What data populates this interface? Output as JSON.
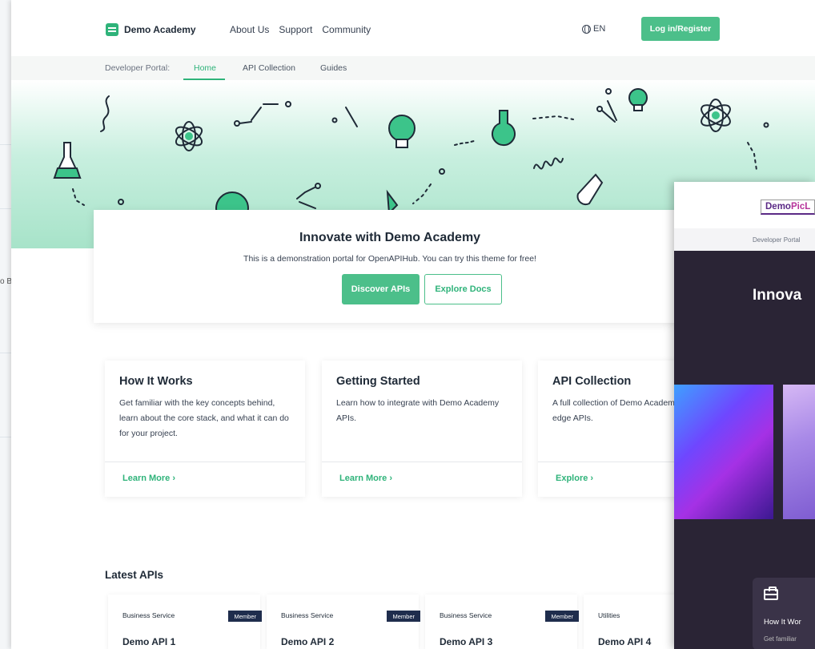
{
  "bg_left": {
    "text": "o Ba"
  },
  "nav": {
    "logo": "Demo Academy",
    "links": [
      "About Us",
      "Support",
      "Community"
    ],
    "lang": "EN",
    "login": "Log in/Register"
  },
  "subnav": {
    "label": "Developer Portal:",
    "tabs": [
      "Home",
      "API Collection",
      "Guides"
    ],
    "active_tab": "Home"
  },
  "intro": {
    "title": "Innovate with Demo Academy",
    "subtitle": "This is a demonstration portal for OpenAPIHub. You can try this theme for free!",
    "discover": "Discover APIs",
    "explore": "Explore Docs"
  },
  "features": [
    {
      "title": "How It Works",
      "desc": "Get familiar with the key concepts behind, learn about the core stack, and what it can do for your project.",
      "link": "Learn More ›"
    },
    {
      "title": "Getting Started",
      "desc": "Learn how to integrate with Demo Academy APIs.",
      "link": "Learn More ›"
    },
    {
      "title": "API Collection",
      "desc": "A full collection of Demo Academy leading edge APIs.",
      "link": "Explore ›"
    }
  ],
  "latest": {
    "title": "Latest APIs",
    "apis": [
      {
        "category": "Business Service",
        "badge": "Member",
        "name": "Demo API 1"
      },
      {
        "category": "Business Service",
        "badge": "Member",
        "name": "Demo API 2"
      },
      {
        "category": "Business Service",
        "badge": "Member",
        "name": "Demo API 3"
      },
      {
        "category": "Utilities",
        "badge": "",
        "name": "Demo API 4"
      }
    ]
  },
  "overlay": {
    "logo_a": "Demo",
    "logo_b": "PicL",
    "sub_label": "Developer Portal",
    "title": "Innova",
    "card_title": "How It Wor",
    "card_desc": "Get familiar"
  },
  "colors": {
    "accent": "#4cbf8a",
    "accent_dark": "#2fb37a",
    "badge": "#1f2d4d",
    "overlay_bg": "#2a2435"
  }
}
